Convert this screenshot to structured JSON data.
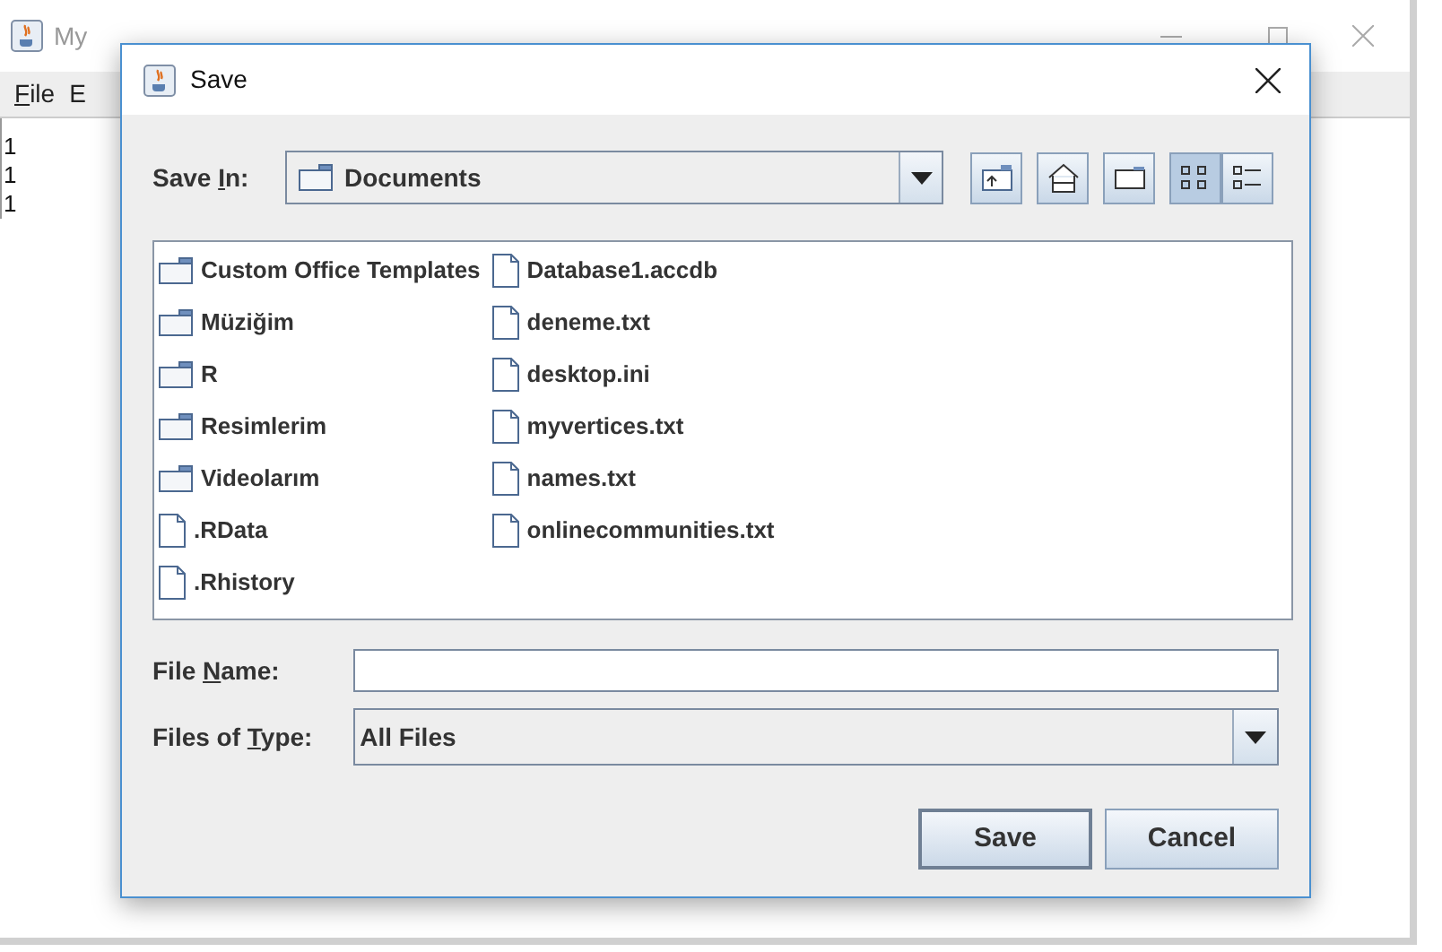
{
  "main_window": {
    "title": "My",
    "menu": [
      {
        "key": "F",
        "rest": "ile"
      },
      {
        "key": "E"
      }
    ],
    "text_lines": [
      "1",
      "1",
      "1"
    ]
  },
  "dialog": {
    "title": "Save",
    "save_in": {
      "label_parts": [
        "Save ",
        "I",
        "n:"
      ],
      "value": "Documents"
    },
    "files": [
      {
        "name": "Custom Office Templates",
        "kind": "folder"
      },
      {
        "name": "Müziğim",
        "kind": "folder"
      },
      {
        "name": "R",
        "kind": "folder"
      },
      {
        "name": "Resimlerim",
        "kind": "folder"
      },
      {
        "name": "Videolarım",
        "kind": "folder"
      },
      {
        "name": ".RData",
        "kind": "file"
      },
      {
        "name": ".Rhistory",
        "kind": "file"
      },
      {
        "name": "Database1.accdb",
        "kind": "file"
      },
      {
        "name": "deneme.txt",
        "kind": "file"
      },
      {
        "name": "desktop.ini",
        "kind": "file"
      },
      {
        "name": "myvertices.txt",
        "kind": "file"
      },
      {
        "name": "names.txt",
        "kind": "file"
      },
      {
        "name": "onlinecommunities.txt",
        "kind": "file"
      }
    ],
    "view_mode": [
      {
        "kind": "list",
        "selected": true
      },
      {
        "kind": "details",
        "selected": false
      }
    ],
    "file_name": {
      "label_parts": [
        "File ",
        "N",
        "ame:"
      ]
    },
    "file_type": {
      "label_parts": [
        "Files of ",
        "T",
        "ype:"
      ],
      "value": "All Files"
    },
    "buttons": [
      {
        "label": "Save"
      },
      {
        "label": "Cancel"
      }
    ]
  }
}
